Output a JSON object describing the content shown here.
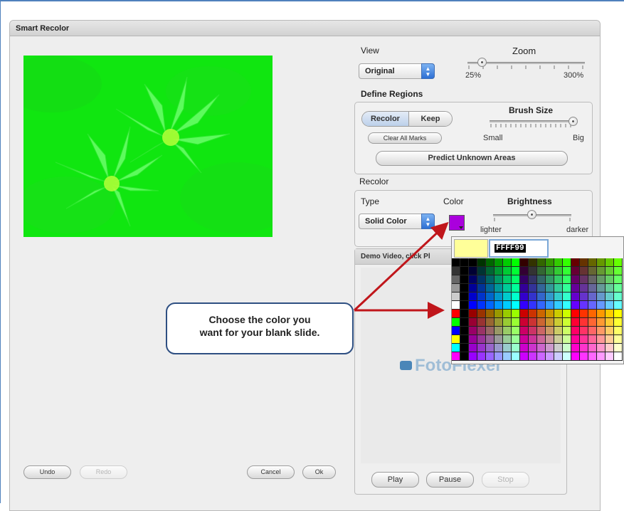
{
  "dialog": {
    "title": "Smart Recolor"
  },
  "view": {
    "label": "View",
    "select_value": "Original",
    "zoom": {
      "label": "Zoom",
      "min_label": "25%",
      "max_label": "300%",
      "value_fraction": 0.06
    }
  },
  "define_regions": {
    "label": "Define Regions",
    "segment": {
      "recolor": "Recolor",
      "keep": "Keep",
      "active": "Recolor"
    },
    "clear_all_marks": "Clear All Marks",
    "brush": {
      "label": "Brush Size",
      "min_label": "Small",
      "max_label": "Big",
      "value_fraction": 1.0
    },
    "predict_unknown_areas": "Predict Unknown Areas"
  },
  "recolor": {
    "label": "Recolor",
    "type_label": "Type",
    "type_value": "Solid Color",
    "color_label": "Color",
    "color_value": "#AA00DD",
    "brightness": {
      "label": "Brightness",
      "min_label": "lighter",
      "max_label": "darker",
      "value_fraction": 0.5
    }
  },
  "demo_video": {
    "header": "Demo Video, click Pl",
    "logo": "FotoFlexer",
    "buttons": {
      "play": "Play",
      "pause": "Pause",
      "stop": "Stop"
    }
  },
  "palette": {
    "selected_hex": "FFFF99",
    "selected_color": "#FFFF99"
  },
  "footer": {
    "undo": "Undo",
    "redo": "Redo",
    "cancel": "Cancel",
    "ok": "Ok"
  },
  "callout": {
    "line1": "Choose the color you",
    "line2": "want for your blank slide."
  },
  "colors": {
    "preview_green": "#10E610",
    "annotation_red": "#C0161B",
    "callout_border": "#2E4F82"
  }
}
